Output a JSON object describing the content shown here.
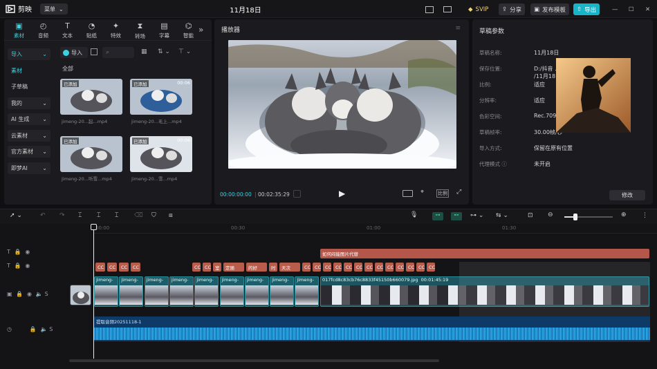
{
  "app": {
    "logo_text": "剪映",
    "menu_label": "菜单",
    "title": "11月18日",
    "svip_label": "SVIP",
    "share_label": "分享",
    "publish_template_label": "发布模板",
    "export_label": "导出"
  },
  "media": {
    "tabs": [
      {
        "label": "素材",
        "icon": "media-icon",
        "active": true
      },
      {
        "label": "音频",
        "icon": "audio-icon"
      },
      {
        "label": "文本",
        "icon": "text-icon"
      },
      {
        "label": "贴纸",
        "icon": "sticker-icon"
      },
      {
        "label": "特效",
        "icon": "effects-icon"
      },
      {
        "label": "转场",
        "icon": "transition-icon"
      },
      {
        "label": "字幕",
        "icon": "caption-icon"
      },
      {
        "label": "智能",
        "icon": "smart-icon"
      }
    ],
    "nav": [
      {
        "label": "导入",
        "drop": true,
        "active": true
      },
      {
        "label": "素材",
        "drop": false,
        "active": true
      },
      {
        "label": "子草稿",
        "drop": false
      },
      {
        "label": "我的",
        "drop": true
      },
      {
        "label": "AI 生成",
        "drop": true
      },
      {
        "label": "云素材",
        "drop": true
      },
      {
        "label": "官方素材",
        "drop": true
      },
      {
        "label": "即梦AI",
        "drop": true
      }
    ],
    "import_label": "导入",
    "section_label": "全部",
    "items": [
      {
        "tag": "已添加",
        "duration": "",
        "caption": "jimeng-20...起...mp4",
        "scene": "huskies"
      },
      {
        "tag": "已添加",
        "duration": "00:06",
        "caption": "jimeng-20...毛上...mp4",
        "scene": "pups"
      },
      {
        "tag": "已添加",
        "duration": "",
        "caption": "jimeng-20...听雪...mp4",
        "scene": "snow"
      },
      {
        "tag": "已添加",
        "duration": "00:06",
        "caption": "jimeng-20...雪...mp4",
        "scene": "run"
      }
    ]
  },
  "player": {
    "title": "播放器",
    "current_time": "00:00:00:00",
    "total_time": "00:02:35:29",
    "ratio_label": "比例"
  },
  "props": {
    "title": "草稿参数",
    "modify_label": "修改",
    "rows": [
      {
        "k": "草稿名称:",
        "v": "11月18日"
      },
      {
        "k": "保存位置:",
        "v": "D:/抖音 ... /11月18日"
      },
      {
        "k": "比例:",
        "v": "适应"
      },
      {
        "k": "分辨率:",
        "v": "适应"
      },
      {
        "k": "色彩空间:",
        "v": "Rec.709"
      },
      {
        "k": "草稿帧率:",
        "v": "30.00帧/秒"
      },
      {
        "k": "导入方式:",
        "v": "保留在原有位置"
      },
      {
        "k": "代理模式 ⓘ",
        "v": "未开启"
      }
    ]
  },
  "timeline": {
    "ruler": [
      "00:00",
      "00:30",
      "01:00",
      "01:30"
    ],
    "text_track_main": "如何闷能图片代替",
    "text_chips": [
      "CC",
      "CC",
      "CC",
      "CC",
      "CC",
      "CC",
      "室",
      "定随",
      "的好",
      "时",
      "天次",
      "CC",
      "CC",
      "CC",
      "CC",
      "CC",
      "CC",
      "CC",
      "CC",
      "CC",
      "CC",
      "CC",
      "CC",
      "CC"
    ],
    "video_clips": [
      "jimeng-",
      "jimeng-",
      "jimeng-",
      "jimeng-",
      "jimeng-",
      "jimeng-",
      "jimeng-",
      "jimeng-",
      "jimeng-"
    ],
    "long_clip": "017fcd8c83cb76c8833f45150b660079.jpg",
    "long_clip_time": "00:01:45:19",
    "audio_label": "提取音频20251118-1",
    "cover_label": "封面"
  }
}
